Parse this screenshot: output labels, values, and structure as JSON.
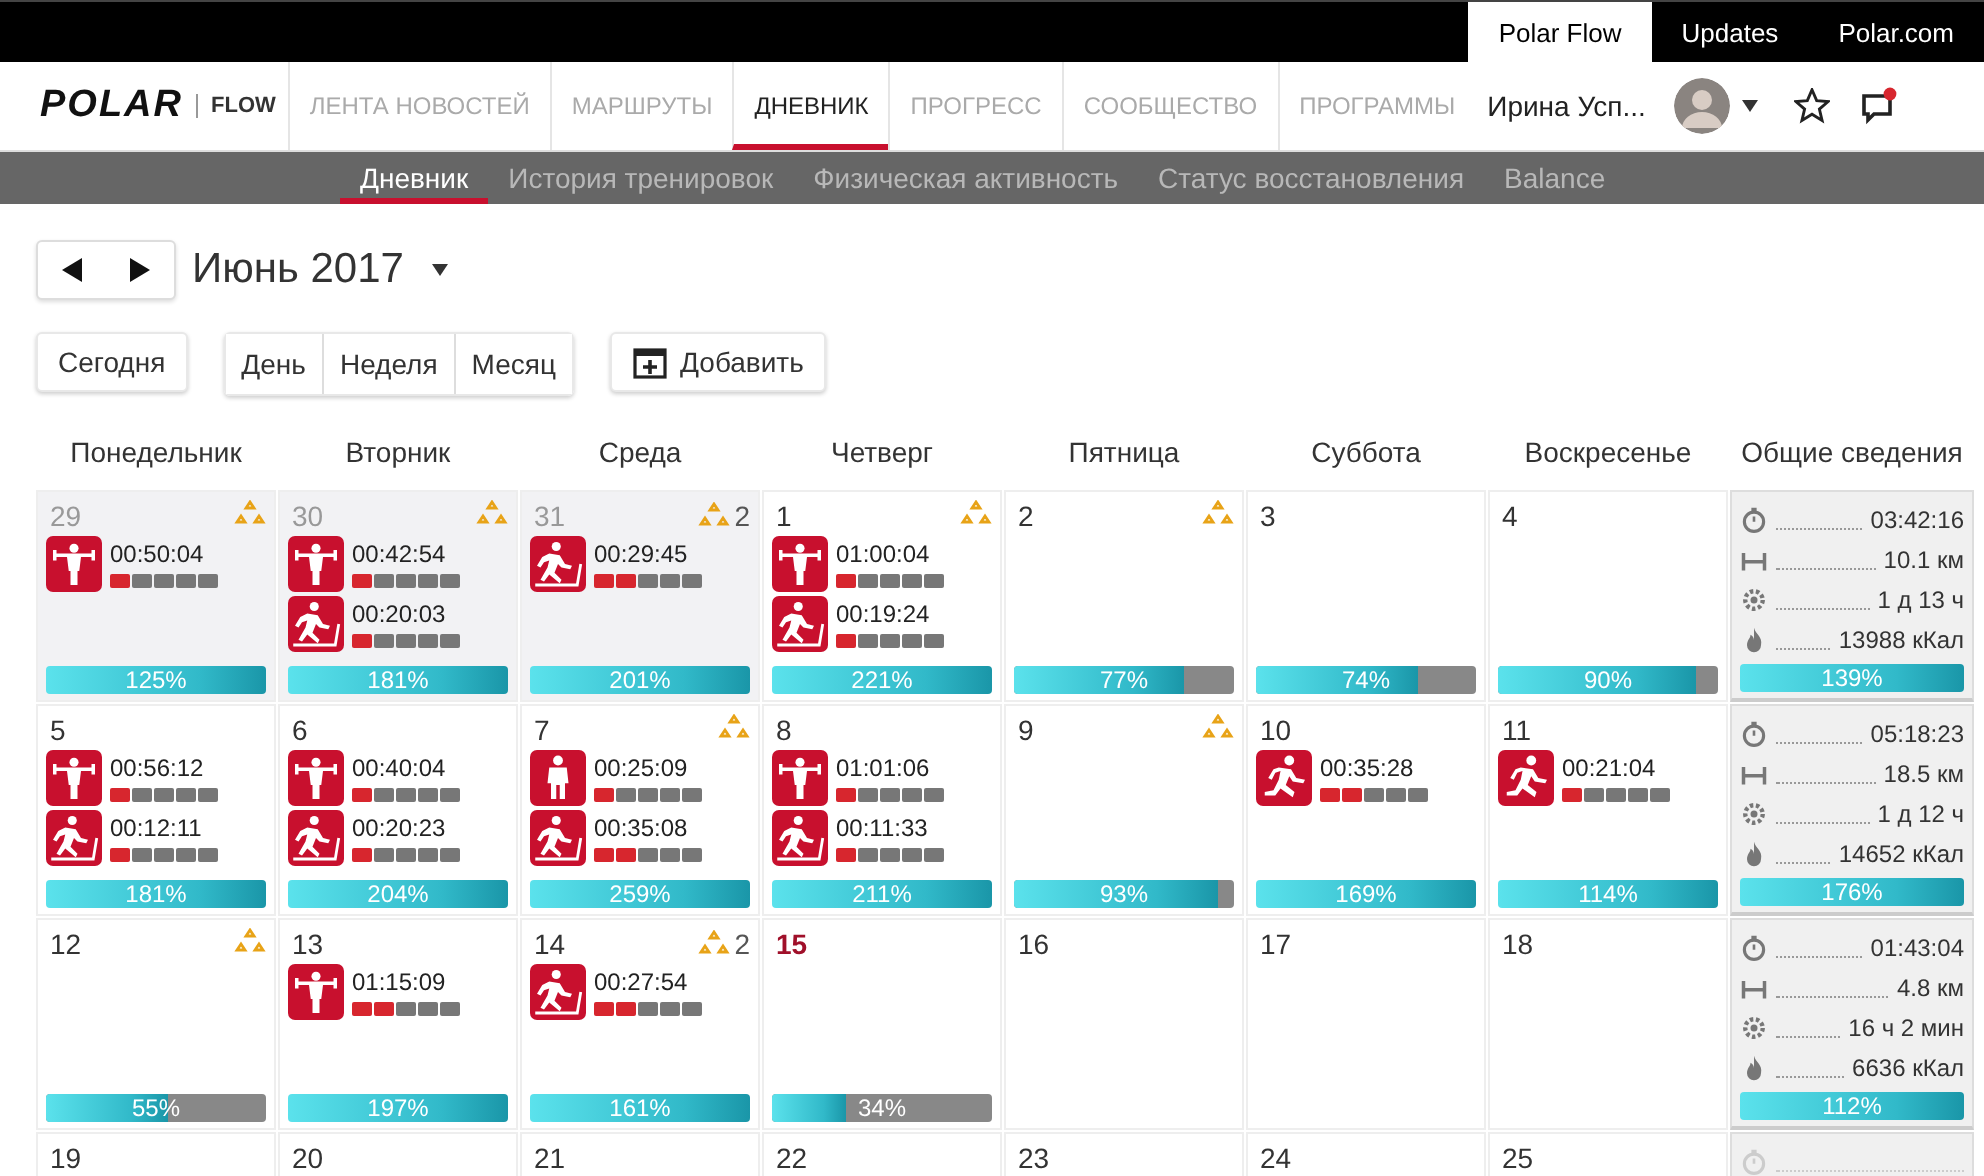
{
  "top_links": [
    {
      "label": "Polar Flow",
      "selected": true
    },
    {
      "label": "Updates",
      "selected": false
    },
    {
      "label": "Polar.com",
      "selected": false
    }
  ],
  "logo": {
    "brand": "POLAR",
    "product": "FLOW"
  },
  "nav": [
    {
      "label": "ЛЕНТА НОВОСТЕЙ",
      "selected": false
    },
    {
      "label": "МАРШРУТЫ",
      "selected": false
    },
    {
      "label": "ДНЕВНИК",
      "selected": true
    },
    {
      "label": "ПРОГРЕСС",
      "selected": false
    },
    {
      "label": "СООБЩЕСТВО",
      "selected": false
    },
    {
      "label": "ПРОГРАММЫ",
      "selected": false
    }
  ],
  "user": {
    "name": "Ирина Усп..."
  },
  "subnav": [
    {
      "label": "Дневник",
      "selected": true
    },
    {
      "label": "История тренировок",
      "selected": false
    },
    {
      "label": "Физическая активность",
      "selected": false
    },
    {
      "label": "Статус восстановления",
      "selected": false
    },
    {
      "label": "Balance",
      "selected": false
    }
  ],
  "period": {
    "title": "Июнь 2017"
  },
  "buttons": {
    "today": "Сегодня",
    "views": [
      "День",
      "Неделя",
      "Месяц"
    ],
    "add": "Добавить"
  },
  "weekdays": [
    "Понедельник",
    "Вторник",
    "Среда",
    "Четверг",
    "Пятница",
    "Суббота",
    "Воскресенье",
    "Общие сведения"
  ],
  "weeks": [
    {
      "days": [
        {
          "number": "29",
          "past": true,
          "today": false,
          "trophy": true,
          "activities": [
            {
              "kind": "strength",
              "duration": "00:50:04",
              "level": 0.2
            }
          ],
          "bar": {
            "level": 1,
            "label": "125%"
          }
        },
        {
          "number": "30",
          "past": true,
          "today": false,
          "trophy": true,
          "activities": [
            {
              "kind": "strength",
              "duration": "00:42:54",
              "level": 0.2
            },
            {
              "kind": "treadmill",
              "duration": "00:20:03",
              "level": 0.2
            }
          ],
          "bar": {
            "level": 1,
            "label": "181%"
          }
        },
        {
          "number": "31",
          "past": true,
          "today": false,
          "trophy": true,
          "trophy_count": "2",
          "activities": [
            {
              "kind": "treadmill",
              "duration": "00:29:45",
              "level": 0.4
            }
          ],
          "bar": {
            "level": 1,
            "label": "201%"
          }
        },
        {
          "number": "1",
          "past": false,
          "today": false,
          "trophy": true,
          "activities": [
            {
              "kind": "strength",
              "duration": "01:00:04",
              "level": 0.2
            },
            {
              "kind": "treadmill",
              "duration": "00:19:24",
              "level": 0.2
            }
          ],
          "bar": {
            "level": 1,
            "label": "221%"
          }
        },
        {
          "number": "2",
          "past": false,
          "today": false,
          "trophy": true,
          "bar": {
            "level": 0.77,
            "label": "77%"
          }
        },
        {
          "number": "3",
          "past": false,
          "today": false,
          "trophy": false,
          "bar": {
            "level": 0.74,
            "label": "74%"
          }
        },
        {
          "number": "4",
          "past": false,
          "today": false,
          "trophy": false,
          "bar": {
            "level": 0.9,
            "label": "90%"
          }
        }
      ],
      "summary": {
        "stats": [
          {
            "kind": "time",
            "value": "03:42:16"
          },
          {
            "kind": "distance",
            "value": "10.1 км"
          },
          {
            "kind": "recovery",
            "value": "1 д 13 ч"
          },
          {
            "kind": "calories",
            "value": "13988 кКал"
          }
        ],
        "bar": {
          "level": 1,
          "label": "139%"
        }
      }
    },
    {
      "days": [
        {
          "number": "5",
          "past": false,
          "today": false,
          "trophy": false,
          "activities": [
            {
              "kind": "strength",
              "duration": "00:56:12",
              "level": 0.2
            },
            {
              "kind": "treadmill",
              "duration": "00:12:11",
              "level": 0.2
            }
          ],
          "bar": {
            "level": 1,
            "label": "181%"
          }
        },
        {
          "number": "6",
          "past": false,
          "today": false,
          "trophy": false,
          "activities": [
            {
              "kind": "strength",
              "duration": "00:40:04",
              "level": 0.2
            },
            {
              "kind": "treadmill",
              "duration": "00:20:23",
              "level": 0.2
            }
          ],
          "bar": {
            "level": 1,
            "label": "204%"
          }
        },
        {
          "number": "7",
          "past": false,
          "today": false,
          "trophy": true,
          "activities": [
            {
              "kind": "standing",
              "duration": "00:25:09",
              "level": 0.2
            },
            {
              "kind": "treadmill",
              "duration": "00:35:08",
              "level": 0.4
            }
          ],
          "bar": {
            "level": 1,
            "label": "259%"
          }
        },
        {
          "number": "8",
          "past": false,
          "today": false,
          "trophy": false,
          "activities": [
            {
              "kind": "strength",
              "duration": "01:01:06",
              "level": 0.2
            },
            {
              "kind": "treadmill",
              "duration": "00:11:33",
              "level": 0.2
            }
          ],
          "bar": {
            "level": 1,
            "label": "211%"
          }
        },
        {
          "number": "9",
          "past": false,
          "today": false,
          "trophy": true,
          "bar": {
            "level": 0.93,
            "label": "93%"
          }
        },
        {
          "number": "10",
          "past": false,
          "today": false,
          "trophy": false,
          "activities": [
            {
              "kind": "running",
              "duration": "00:35:28",
              "level": 0.4
            }
          ],
          "bar": {
            "level": 1,
            "label": "169%"
          }
        },
        {
          "number": "11",
          "past": false,
          "today": false,
          "trophy": false,
          "activities": [
            {
              "kind": "running",
              "duration": "00:21:04",
              "level": 0.2
            }
          ],
          "bar": {
            "level": 1,
            "label": "114%"
          }
        }
      ],
      "summary": {
        "stats": [
          {
            "kind": "time",
            "value": "05:18:23"
          },
          {
            "kind": "distance",
            "value": "18.5 км"
          },
          {
            "kind": "recovery",
            "value": "1 д 12 ч"
          },
          {
            "kind": "calories",
            "value": "14652 кКал"
          }
        ],
        "bar": {
          "level": 1,
          "label": "176%"
        }
      }
    },
    {
      "days": [
        {
          "number": "12",
          "past": false,
          "today": false,
          "trophy": true,
          "bar": {
            "level": 0.55,
            "label": "55%"
          }
        },
        {
          "number": "13",
          "past": false,
          "today": false,
          "trophy": false,
          "activities": [
            {
              "kind": "strength",
              "duration": "01:15:09",
              "level": 0.4
            }
          ],
          "bar": {
            "level": 1,
            "label": "197%"
          }
        },
        {
          "number": "14",
          "past": false,
          "today": false,
          "trophy": true,
          "trophy_count": "2",
          "activities": [
            {
              "kind": "treadmill",
              "duration": "00:27:54",
              "level": 0.4
            }
          ],
          "bar": {
            "level": 1,
            "label": "161%"
          }
        },
        {
          "number": "15",
          "past": false,
          "today": true,
          "trophy": false,
          "bar": {
            "level": 0.34,
            "label": "34%"
          }
        },
        {
          "number": "16",
          "past": false,
          "today": false,
          "trophy": false
        },
        {
          "number": "17",
          "past": false,
          "today": false,
          "trophy": false
        },
        {
          "number": "18",
          "past": false,
          "today": false,
          "trophy": false
        }
      ],
      "summary": {
        "stats": [
          {
            "kind": "time",
            "value": "01:43:04"
          },
          {
            "kind": "distance",
            "value": "4.8 км"
          },
          {
            "kind": "recovery",
            "value": "16 ч 2 мин"
          },
          {
            "kind": "calories",
            "value": "6636 кКал"
          }
        ],
        "bar": {
          "level": 1,
          "label": "112%"
        }
      }
    },
    {
      "days": [
        {
          "number": "19",
          "past": false,
          "today": false,
          "trophy": false
        },
        {
          "number": "20",
          "past": false,
          "today": false,
          "trophy": false
        },
        {
          "number": "21",
          "past": false,
          "today": false,
          "trophy": false
        },
        {
          "number": "22",
          "past": false,
          "today": false,
          "trophy": false
        },
        {
          "number": "23",
          "past": false,
          "today": false,
          "trophy": false
        },
        {
          "number": "24",
          "past": false,
          "today": false,
          "trophy": false
        },
        {
          "number": "25",
          "past": false,
          "today": false,
          "trophy": false
        }
      ],
      "summary": {
        "stats": [
          {
            "kind": "time"
          }
        ]
      }
    }
  ]
}
